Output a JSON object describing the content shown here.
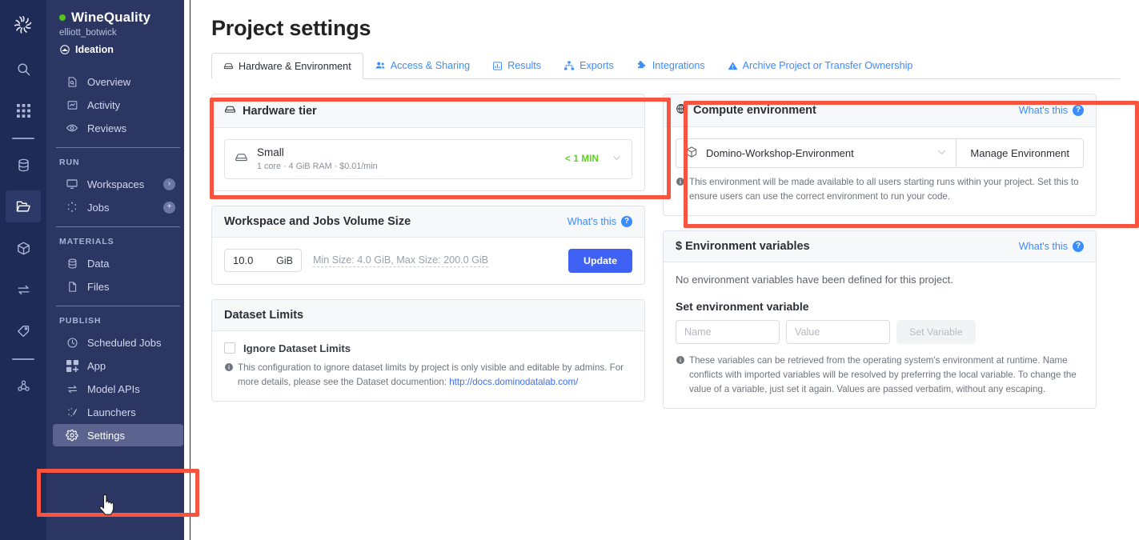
{
  "rail": {
    "logo_name": "domino-logo-icon",
    "items": [
      {
        "name": "search-icon",
        "label": "Search"
      },
      {
        "name": "apps-grid-icon",
        "label": "Apps"
      },
      {
        "name": "database-icon",
        "label": "Data"
      },
      {
        "name": "folder-open-icon",
        "label": "Projects"
      },
      {
        "name": "cube-icon",
        "label": "Environments"
      },
      {
        "name": "transfer-icon",
        "label": "Model APIs"
      },
      {
        "name": "tag-icon",
        "label": "Tags"
      },
      {
        "name": "people-network-icon",
        "label": "Admin"
      }
    ]
  },
  "sidebar": {
    "project_name": "WineQuality",
    "owner": "elliott_botwick",
    "stage": "Ideation",
    "items": [
      {
        "label": "Overview",
        "icon": "overview-icon",
        "badge": ""
      },
      {
        "label": "Activity",
        "icon": "activity-icon",
        "badge": ""
      },
      {
        "label": "Reviews",
        "icon": "eye-icon",
        "badge": ""
      }
    ],
    "group_run_label": "RUN",
    "run_items": [
      {
        "label": "Workspaces",
        "icon": "monitor-icon",
        "badge": "›"
      },
      {
        "label": "Jobs",
        "icon": "jobs-icon",
        "badge": "+"
      }
    ],
    "group_materials_label": "MATERIALS",
    "materials_items": [
      {
        "label": "Data",
        "icon": "database-icon",
        "badge": ""
      },
      {
        "label": "Files",
        "icon": "file-icon",
        "badge": ""
      }
    ],
    "group_publish_label": "PUBLISH",
    "publish_items": [
      {
        "label": "Scheduled Jobs",
        "icon": "clock-icon",
        "badge": ""
      },
      {
        "label": "App",
        "icon": "app-grid-icon",
        "badge": ""
      },
      {
        "label": "Model APIs",
        "icon": "transfer-icon",
        "badge": ""
      },
      {
        "label": "Launchers",
        "icon": "launcher-icon",
        "badge": ""
      },
      {
        "label": "Settings",
        "icon": "gear-icon",
        "badge": ""
      }
    ]
  },
  "header": {
    "title": "Project settings"
  },
  "tabs": [
    {
      "label": "Hardware & Environment",
      "icon": "hardware-icon",
      "active": true
    },
    {
      "label": "Access & Sharing",
      "icon": "people-icon",
      "active": false
    },
    {
      "label": "Results",
      "icon": "bar-chart-icon",
      "active": false
    },
    {
      "label": "Exports",
      "icon": "sitemap-icon",
      "active": false
    },
    {
      "label": "Integrations",
      "icon": "puzzle-icon",
      "active": false
    },
    {
      "label": "Archive Project or Transfer Ownership",
      "icon": "warning-icon",
      "active": false
    }
  ],
  "hardware_tier": {
    "title": "Hardware tier",
    "tier_name": "Small",
    "tier_specs": "1 core · 4 GiB RAM · $0.01/min",
    "start_time": "< 1 MIN"
  },
  "volume": {
    "title": "Workspace and Jobs Volume Size",
    "whats_this": "What's this",
    "size_value": "10.0",
    "size_unit": "GiB",
    "hint": "Min Size: 4.0 GiB, Max Size: 200.0 GiB",
    "update_label": "Update"
  },
  "dataset_limits": {
    "title": "Dataset Limits",
    "checkbox_label": "Ignore Dataset Limits",
    "checked": false,
    "note": "This configuration to ignore dataset limits by project is only visible and editable by admins. For more details, please see the Dataset documention: ",
    "link": "http://docs.dominodatalab.com/"
  },
  "compute_environment": {
    "title": "Compute environment",
    "whats_this": "What's this",
    "selected": "Domino-Workshop-Environment",
    "manage_label": "Manage Environment",
    "note": "This environment will be made available to all users starting runs within your project. Set this to ensure users can use the correct environment to run your code."
  },
  "environment_variables": {
    "title": "$ Environment variables",
    "whats_this": "What's this",
    "empty": "No environment variables have been defined for this project.",
    "sub_head": "Set environment variable",
    "name_placeholder": "Name",
    "value_placeholder": "Value",
    "set_label": "Set Variable",
    "note": "These variables can be retrieved from the operating system's environment at runtime. Name conflicts with imported variables will be resolved by preferring the local variable. To change the value of a variable, just set it again. Values are passed verbatim, without any escaping."
  },
  "annotations": {
    "highlight_color": "#f9543f",
    "boxes": [
      "hardware-tier-card",
      "compute-environment-card",
      "sidebar-settings-item"
    ]
  },
  "colors": {
    "rail_bg": "#1f2b57",
    "sidebar_bg": "#2b3663",
    "accent_blue": "#3b8cff",
    "primary_button": "#3f62f5",
    "green_status": "#5dd221",
    "project_dot": "#52c41a"
  }
}
